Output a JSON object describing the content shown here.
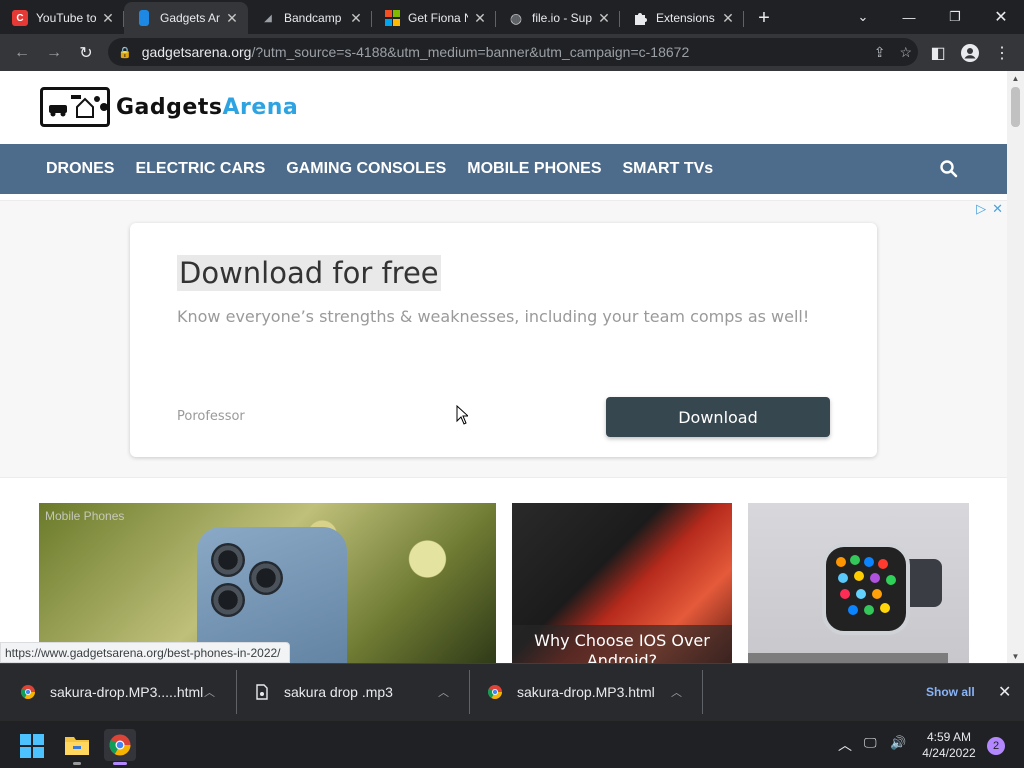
{
  "browser": {
    "tabs": [
      {
        "title": "YouTube to",
        "favicon": "youtube-converter-icon",
        "active": false
      },
      {
        "title": "Gadgets Ar",
        "favicon": "gadgets-arena-icon",
        "active": true
      },
      {
        "title": "Bandcamp",
        "favicon": "bandcamp-icon",
        "active": false
      },
      {
        "title": "Get Fiona N",
        "favicon": "microsoft-icon",
        "active": false
      },
      {
        "title": "file.io - Sup",
        "favicon": "globe-icon",
        "active": false
      },
      {
        "title": "Extensions",
        "favicon": "puzzle-icon",
        "active": false
      }
    ],
    "url_host": "gadgetsarena.org",
    "url_rest": "/?utm_source=s-4188&utm_medium=banner&utm_campaign=c-18672"
  },
  "site": {
    "logo_part1": "Gadgets",
    "logo_part2": "Arena",
    "nav": [
      "DRONES",
      "ELECTRIC CARS",
      "GAMING CONSOLES",
      "MOBILE PHONES",
      "SMART TVs"
    ]
  },
  "ad": {
    "headline": "Download for free",
    "subtext": "Know everyone’s strengths & weaknesses, including your team comps as well!",
    "advertiser": "Porofessor",
    "cta": "Download"
  },
  "cards": [
    {
      "category": "Mobile Phones"
    },
    {
      "caption": "Why Choose IOS Over Android?"
    },
    {
      "caption": ""
    }
  ],
  "status_url": "https://www.gadgetsarena.org/best-phones-in-2022/",
  "downloads": {
    "items": [
      {
        "name": "sakura-drop.MP3.....html",
        "icon": "chrome-icon"
      },
      {
        "name": "sakura drop .mp3",
        "icon": "file-icon"
      },
      {
        "name": "sakura-drop.MP3.html",
        "icon": "chrome-icon"
      }
    ],
    "show_all": "Show all"
  },
  "taskbar": {
    "time": "4:59 AM",
    "date": "4/24/2022",
    "notifications": "2"
  },
  "colors": {
    "nav_bg": "#4d6b8a",
    "logo_accent": "#2ea3e2",
    "ad_button": "#37474f"
  }
}
